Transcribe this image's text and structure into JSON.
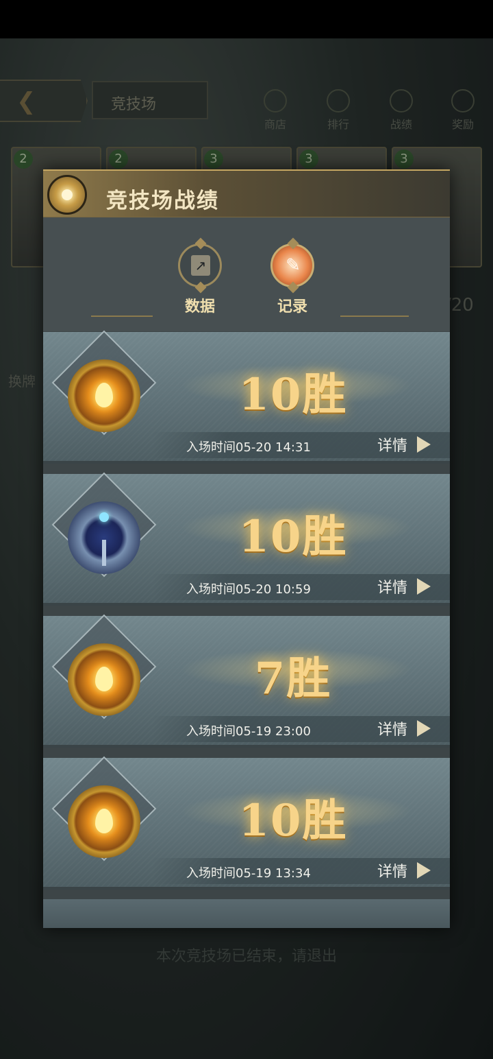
{
  "background": {
    "title": "竞技场",
    "tabs": [
      "商店",
      "排行",
      "战绩",
      "奖励"
    ],
    "card_levels": [
      "2",
      "2",
      "3",
      "3",
      "3"
    ],
    "side_label": "换牌",
    "counter": "/20",
    "footer": "本次竞技场已结束，请退出"
  },
  "dialog": {
    "title": "竞技场战绩",
    "tabs": [
      {
        "label": "数据",
        "icon": "chart-icon",
        "active": false
      },
      {
        "label": "记录",
        "icon": "quill-icon",
        "active": true
      }
    ],
    "records": [
      {
        "wins": "10胜",
        "badge": "gold-badge",
        "time": "入场时间05-20 14:31",
        "detail": "详情"
      },
      {
        "wins": "10胜",
        "badge": "blue-badge",
        "time": "入场时间05-20 10:59",
        "detail": "详情"
      },
      {
        "wins": "7胜",
        "badge": "gold-badge",
        "time": "入场时间05-19 23:00",
        "detail": "详情"
      },
      {
        "wins": "10胜",
        "badge": "gold-badge",
        "time": "入场时间05-19 13:34",
        "detail": "详情"
      }
    ]
  },
  "colors": {
    "header_gold": "#8f7a4b",
    "title_text": "#f3e6c3",
    "wins_text": "#f7d48a",
    "panel_bg": "#3d4547"
  }
}
